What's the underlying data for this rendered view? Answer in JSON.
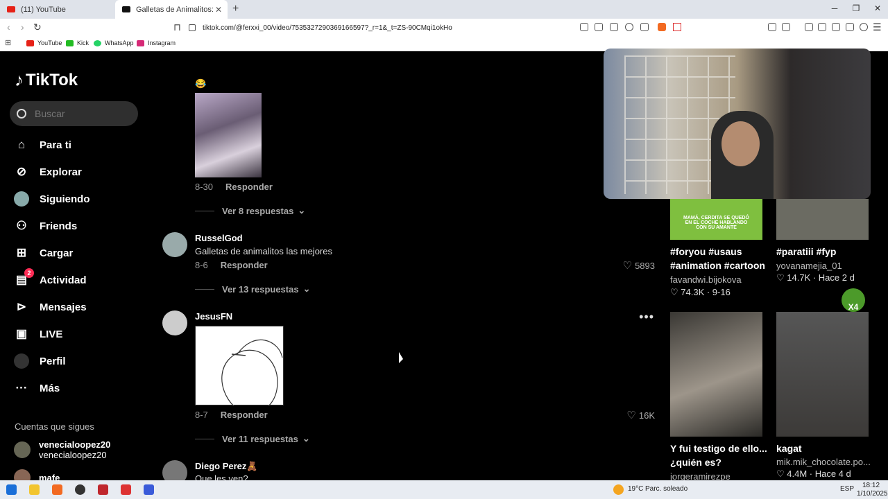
{
  "browser": {
    "tabs": [
      {
        "title": "(11) YouTube",
        "favicon_color": "#e62117",
        "active": false
      },
      {
        "title": "Galletas de Animalitos: Receta P",
        "favicon_color": "#111111",
        "active": true
      }
    ],
    "new_tab": "+",
    "window_controls": {
      "minimize": "─",
      "restore": "❐",
      "close": "✕"
    },
    "url": "tiktok.com/@ferxxi_00/video/7535327290369166597?_r=1&_t=ZS-90CMqi1okHo",
    "bookmarks": [
      {
        "label": "YouTube",
        "color": "#e62117"
      },
      {
        "label": "Kick",
        "color": "#22bb22"
      },
      {
        "label": "WhatsApp",
        "color": "#25d366"
      },
      {
        "label": "Instagram",
        "color": "#d62976"
      }
    ]
  },
  "sidebar": {
    "logo": "TikTok",
    "search_placeholder": "Buscar",
    "nav": [
      {
        "label": "Para ti",
        "icon": "home-icon",
        "glyph": "⌂"
      },
      {
        "label": "Explorar",
        "icon": "compass-icon",
        "glyph": "⊘"
      },
      {
        "label": "Siguiendo",
        "icon": "following-avatar-icon",
        "glyph": "◉"
      },
      {
        "label": "Friends",
        "icon": "friends-icon",
        "glyph": "⚇"
      },
      {
        "label": "Cargar",
        "icon": "upload-icon",
        "glyph": "⊞"
      },
      {
        "label": "Actividad",
        "icon": "activity-icon",
        "glyph": "▤",
        "badge": "2"
      },
      {
        "label": "Mensajes",
        "icon": "messages-icon",
        "glyph": "⊳"
      },
      {
        "label": "LIVE",
        "icon": "live-icon",
        "glyph": "▣"
      },
      {
        "label": "Perfil",
        "icon": "profile-avatar-icon",
        "glyph": "●"
      },
      {
        "label": "Más",
        "icon": "more-icon",
        "glyph": "···"
      }
    ],
    "following_title": "Cuentas que sigues",
    "following": [
      {
        "name": "venecialoopez20",
        "handle": "venecialoopez20"
      },
      {
        "name": "mafe",
        "handle": ""
      }
    ]
  },
  "comments": {
    "first": {
      "emoji": "😂",
      "date": "8-30",
      "reply": "Responder",
      "replies": "Ver 8 respuestas"
    },
    "russel": {
      "user": "RusselGod",
      "text": "Galletas de animalitos las mejores",
      "date": "8-6",
      "reply": "Responder",
      "likes": "5893",
      "replies": "Ver 13 respuestas"
    },
    "jesus": {
      "user": "JesusFN",
      "date": "8-7",
      "reply": "Responder",
      "likes": "16K",
      "replies": "Ver 11 respuestas"
    },
    "diego": {
      "user": "Diego Perez🧸",
      "text": "Que les ven?"
    }
  },
  "related": [
    {
      "title": "#foryou #usaus #animation #cartoon",
      "author": "favandwi.bijokova",
      "stats": "♡ 74.3K · 9-16",
      "thumb_text": "MAMÁ, CERDITA SE QUEDÓ EN EL COCHE HABLANDO CON SU AMANTE"
    },
    {
      "title": "#paratiii #fyp",
      "author": "yovanamejia_01",
      "stats": "♡ 14.7K · Hace 2 d"
    },
    {
      "title": "Y fui testigo de ello... ¿quién es?",
      "author": "jorgeramirezpe",
      "stats": ""
    },
    {
      "title": "kagat",
      "author": "mik.mik_chocolate.po...",
      "stats": "♡ 4.4M · Hace 4 d"
    }
  ],
  "overlay": {
    "emote_text": "X4"
  },
  "taskbar": {
    "weather": "19°C",
    "weather_desc": "Parc. soleado",
    "lang": "ESP",
    "time": "18:12",
    "date": "1/10/2025"
  }
}
